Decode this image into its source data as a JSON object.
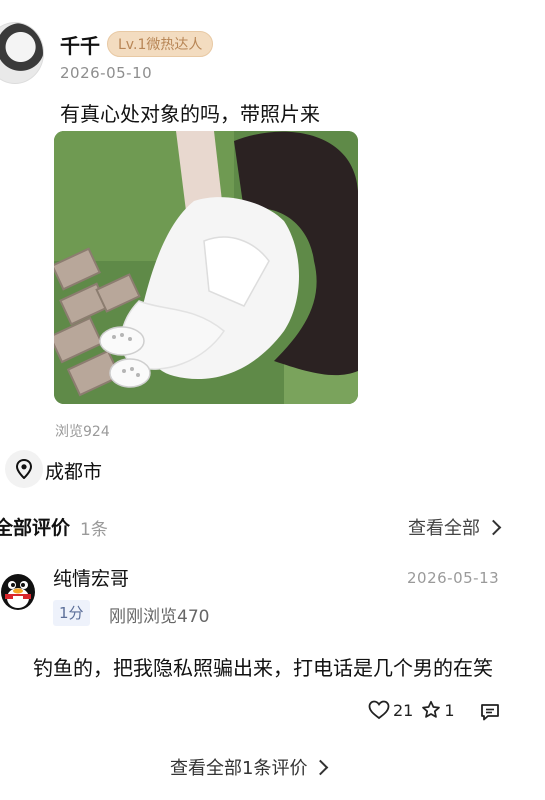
{
  "post": {
    "author": "千千",
    "level_badge": "Lv.1微热达人",
    "date": "2026-05-10",
    "text": "有真心处对象的吗，带照片来",
    "views": "浏览924",
    "location": "成都市",
    "photo_icon": "photo-girl-white-dress"
  },
  "comments_section": {
    "title": "全部评价",
    "count": "1条",
    "view_all": "查看全部"
  },
  "comment": {
    "author": "纯情宏哥",
    "date": "2026-05-13",
    "score": "1分",
    "views": "刚刚浏览470",
    "text": "钓鱼的，把我隐私照骗出来，打电话是几个男的在笑",
    "likes": "21",
    "stars": "1",
    "avatar_icon": "qq-penguin-avatar"
  },
  "footer": {
    "view_all_comments": "查看全部1条评价"
  },
  "colors": {
    "badge_bg": "#f3dcc0",
    "badge_text": "#b88656",
    "score_bg": "#eef2fb",
    "score_text": "#5c6f99",
    "muted": "#9a9a9a"
  }
}
